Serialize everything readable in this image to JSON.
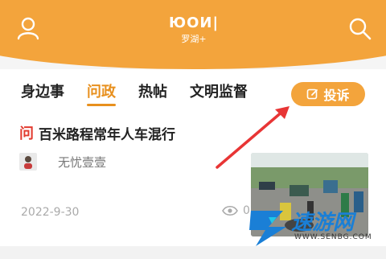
{
  "header": {
    "logo_mark": "ЮOИ|",
    "logo_sub": "罗湖+",
    "profile_icon": "user-icon",
    "search_icon": "search-icon",
    "accent_color": "#f3a43c"
  },
  "tabs": [
    {
      "label": "身边事",
      "active": false
    },
    {
      "label": "问政",
      "active": true
    },
    {
      "label": "热帖",
      "active": false
    },
    {
      "label": "文明监督",
      "active": false
    }
  ],
  "complain_button": {
    "label": "投诉",
    "icon": "edit-icon"
  },
  "post": {
    "badge": "问",
    "title": "百米路程常年人车混行",
    "author": "无忧壹壹",
    "date": "2022-9-30",
    "views": "0"
  },
  "watermark": {
    "brand": "速游网",
    "url": "WWW.SENBG.COM"
  }
}
